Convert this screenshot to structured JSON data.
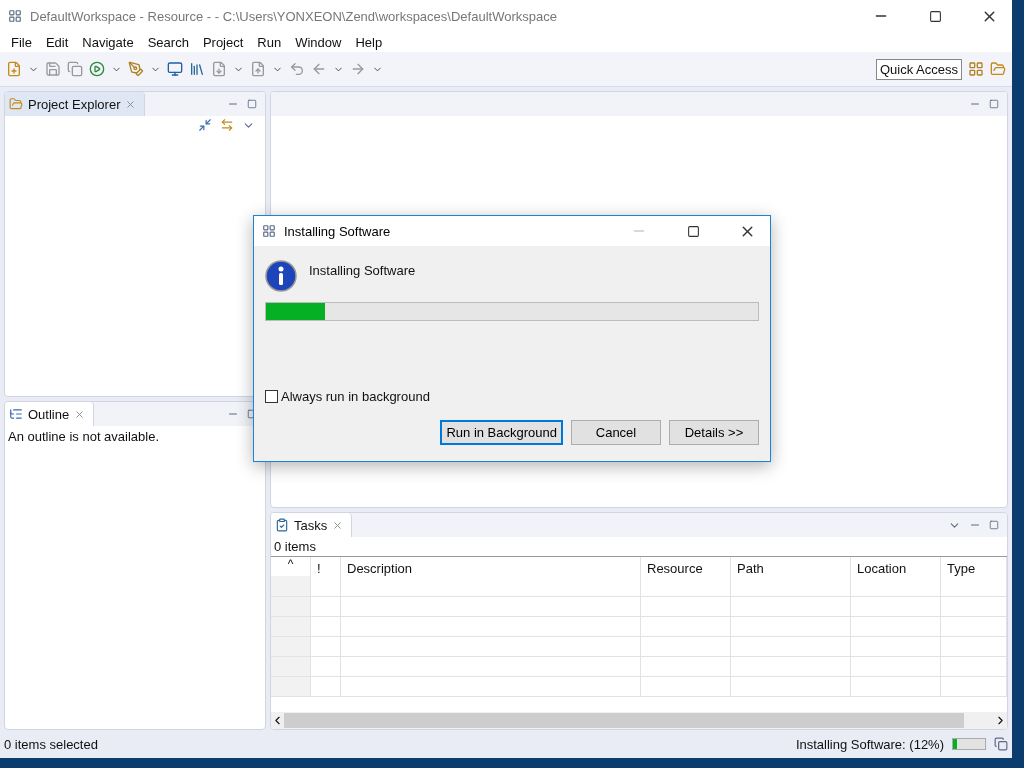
{
  "window": {
    "title": "DefaultWorkspace - Resource -  - C:\\Users\\YONXEON\\Zend\\workspaces\\DefaultWorkspace"
  },
  "menu": [
    "File",
    "Edit",
    "Navigate",
    "Search",
    "Project",
    "Run",
    "Window",
    "Help"
  ],
  "toolbar": {
    "quick_access": "Quick Access"
  },
  "project_explorer": {
    "title": "Project Explorer"
  },
  "outline": {
    "title": "Outline",
    "message": "An outline is not available."
  },
  "tasks": {
    "title": "Tasks",
    "count": "0 items",
    "sort_marker": "^",
    "columns": [
      "!",
      "Description",
      "Resource",
      "Path",
      "Location",
      "Type"
    ]
  },
  "dialog": {
    "title": "Installing Software",
    "heading": "Installing Software",
    "level": 0.12,
    "checkbox": {
      "label": "Always run in background",
      "checked": false
    },
    "buttons": [
      {
        "label": "Run in Background",
        "selected": true
      },
      {
        "label": "Cancel",
        "selected": false
      },
      {
        "label": "Details >>",
        "selected": false
      }
    ]
  },
  "status_bar": {
    "selection": "0 items selected",
    "progress": "Installing Software: (12%)",
    "level": 0.12
  }
}
